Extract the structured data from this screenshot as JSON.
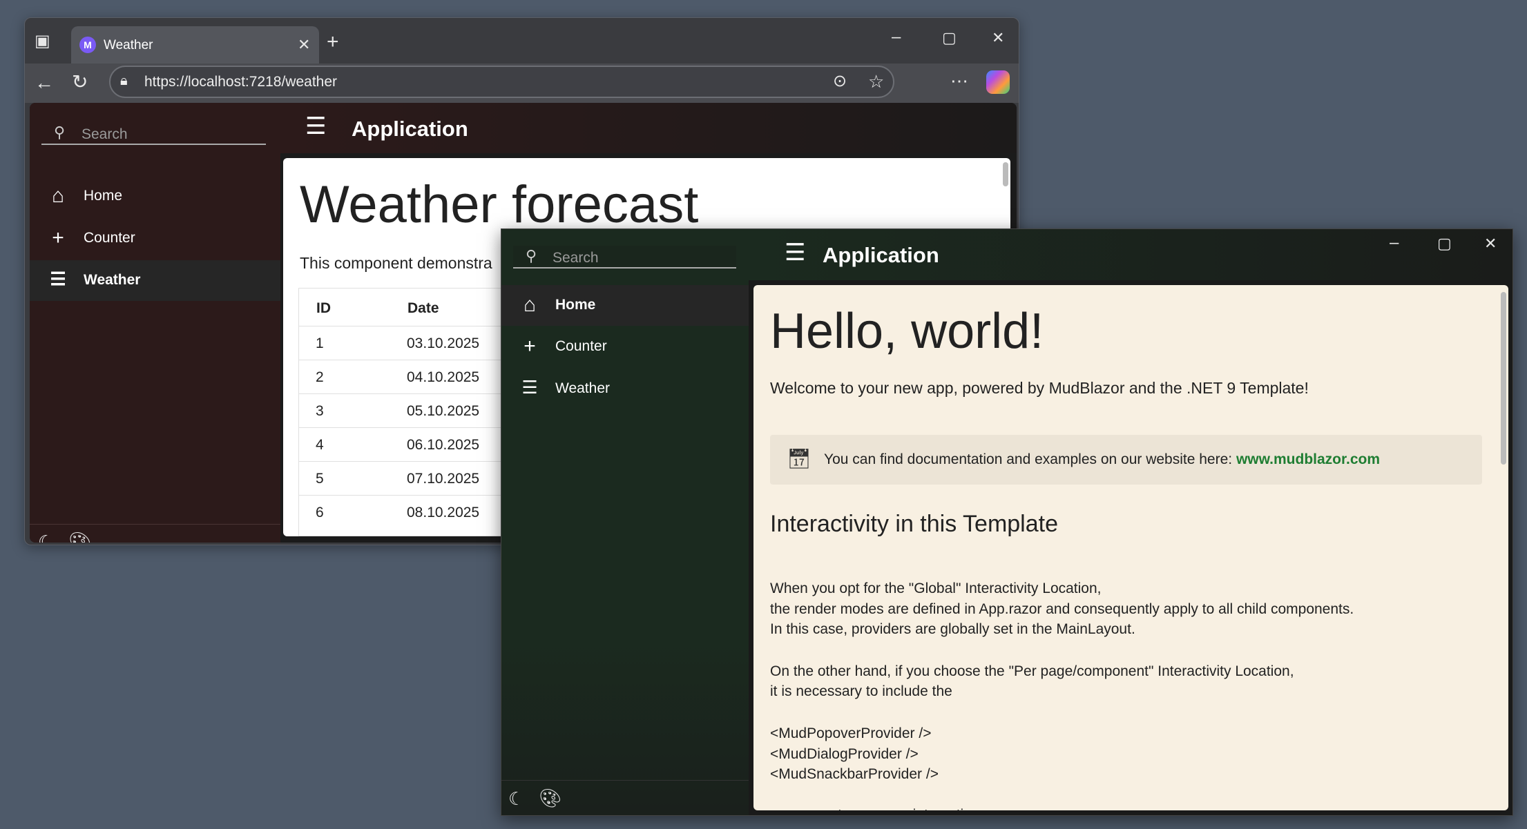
{
  "browser": {
    "tab_title": "Weather",
    "url": "https://localhost:7218/weather",
    "app": {
      "search_placeholder": "Search",
      "title": "Application",
      "nav": [
        {
          "label": "Home",
          "icon": "home-icon"
        },
        {
          "label": "Counter",
          "icon": "plus-icon"
        },
        {
          "label": "Weather",
          "icon": "list-icon",
          "selected": true
        }
      ],
      "page_title": "Weather forecast",
      "intro": "This component demonstra",
      "table": {
        "columns": [
          "ID",
          "Date"
        ],
        "rows": [
          [
            "1",
            "03.10.2025"
          ],
          [
            "2",
            "04.10.2025"
          ],
          [
            "3",
            "05.10.2025"
          ],
          [
            "4",
            "06.10.2025"
          ],
          [
            "5",
            "07.10.2025"
          ],
          [
            "6",
            "08.10.2025"
          ]
        ]
      }
    }
  },
  "desktop_app": {
    "search_placeholder": "Search",
    "title": "Application",
    "nav": [
      {
        "label": "Home",
        "icon": "home-icon",
        "selected": true
      },
      {
        "label": "Counter",
        "icon": "plus-icon"
      },
      {
        "label": "Weather",
        "icon": "list-icon"
      }
    ],
    "heading": "Hello, world!",
    "welcome": "Welcome to your new app, powered by MudBlazor and the .NET 9 Template!",
    "alert_text": "You can find documentation and examples on our website here: ",
    "alert_link": "www.mudblazor.com",
    "subheading": "Interactivity in this Template",
    "lines": [
      "When you opt for the \"Global\" Interactivity Location,",
      "the render modes are defined in App.razor and consequently apply to all child components.",
      "In this case, providers are globally set in the MainLayout.",
      "On the other hand, if you choose the \"Per page/component\" Interactivity Location,",
      "it is necessary to include the",
      "<MudPopoverProvider />",
      "<MudDialogProvider />",
      "<MudSnackbarProvider />",
      "components on every interactive page."
    ]
  },
  "colors": {
    "link": "#1e7d32",
    "browser_sidebar": "#2c1a1a",
    "app_sidebar": "#1b2a1f",
    "app_paper": "#f8f0e2"
  }
}
